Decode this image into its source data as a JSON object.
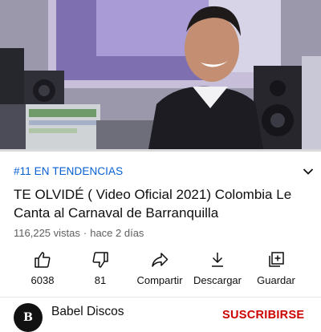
{
  "player": {
    "progress_fraction": 0.0
  },
  "video": {
    "trending_badge": "#11 EN TENDENCIAS",
    "title": "TE OLVIDÉ ( Video Oficial 2021) Colombia Le Canta al Carnaval de Barranquilla",
    "views": "116,225 vistas",
    "separator": "·",
    "age": "hace 2 días"
  },
  "actions": [
    {
      "icon": "thumb-up-icon",
      "label": "6038"
    },
    {
      "icon": "thumb-down-icon",
      "label": "81"
    },
    {
      "icon": "share-icon",
      "label": "Compartir"
    },
    {
      "icon": "download-icon",
      "label": "Descargar"
    },
    {
      "icon": "save-playlist-icon",
      "label": "Guardar"
    }
  ],
  "channel": {
    "avatar_letter": "B",
    "name": "Babel Discos",
    "subscribe_label": "SUSCRIBIRSE"
  },
  "colors": {
    "link_blue": "#065fd4",
    "subscribe_red": "#cc0000",
    "progress_red": "#ff0000",
    "secondary_text": "#606060"
  }
}
